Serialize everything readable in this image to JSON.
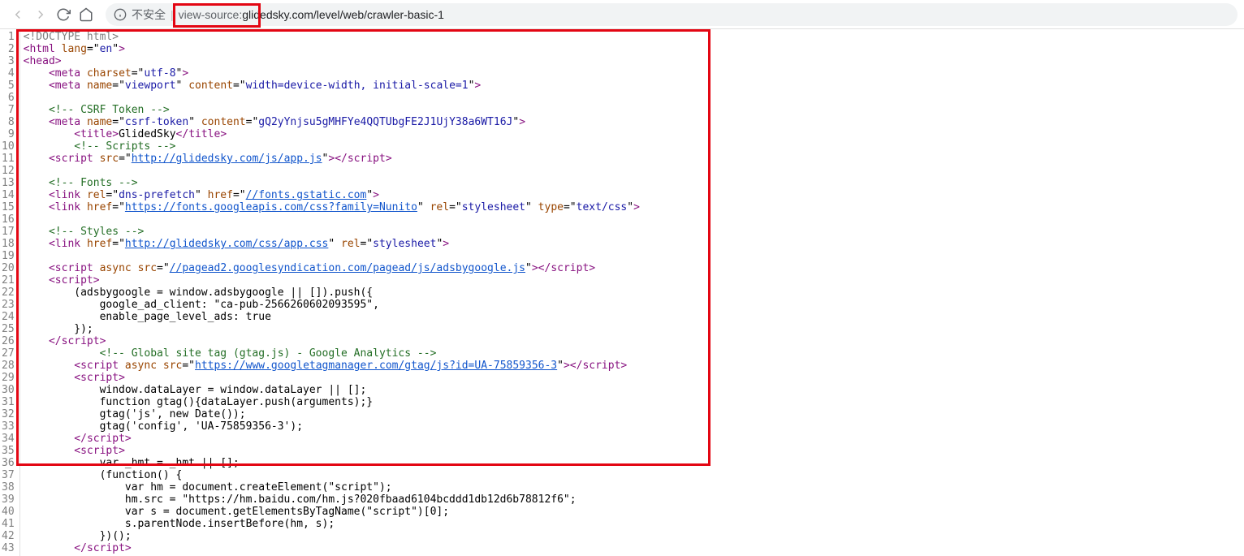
{
  "browser": {
    "security_label": "不安全",
    "url_prefix": "view-source:",
    "url_rest": "glidedsky.com/level/web/crawler-basic-1"
  },
  "lines": [
    {
      "n": "1",
      "segs": [
        {
          "c": "t-doctype",
          "t": "<!DOCTYPE html>"
        }
      ]
    },
    {
      "n": "2",
      "segs": [
        {
          "c": "t-punc",
          "t": "<"
        },
        {
          "c": "t-tag",
          "t": "html"
        },
        {
          "c": "t-text",
          "t": " "
        },
        {
          "c": "t-attr",
          "t": "lang"
        },
        {
          "c": "t-text",
          "t": "=\""
        },
        {
          "c": "t-val",
          "t": "en"
        },
        {
          "c": "t-text",
          "t": "\""
        },
        {
          "c": "t-punc",
          "t": ">"
        }
      ]
    },
    {
      "n": "3",
      "segs": [
        {
          "c": "t-punc",
          "t": "<"
        },
        {
          "c": "t-tag",
          "t": "head"
        },
        {
          "c": "t-punc",
          "t": ">"
        }
      ]
    },
    {
      "n": "4",
      "segs": [
        {
          "c": "t-text",
          "t": "    "
        },
        {
          "c": "t-punc",
          "t": "<"
        },
        {
          "c": "t-tag",
          "t": "meta"
        },
        {
          "c": "t-text",
          "t": " "
        },
        {
          "c": "t-attr",
          "t": "charset"
        },
        {
          "c": "t-text",
          "t": "=\""
        },
        {
          "c": "t-val",
          "t": "utf-8"
        },
        {
          "c": "t-text",
          "t": "\""
        },
        {
          "c": "t-punc",
          "t": ">"
        }
      ]
    },
    {
      "n": "5",
      "segs": [
        {
          "c": "t-text",
          "t": "    "
        },
        {
          "c": "t-punc",
          "t": "<"
        },
        {
          "c": "t-tag",
          "t": "meta"
        },
        {
          "c": "t-text",
          "t": " "
        },
        {
          "c": "t-attr",
          "t": "name"
        },
        {
          "c": "t-text",
          "t": "=\""
        },
        {
          "c": "t-val",
          "t": "viewport"
        },
        {
          "c": "t-text",
          "t": "\" "
        },
        {
          "c": "t-attr",
          "t": "content"
        },
        {
          "c": "t-text",
          "t": "=\""
        },
        {
          "c": "t-val",
          "t": "width=device-width, initial-scale=1"
        },
        {
          "c": "t-text",
          "t": "\""
        },
        {
          "c": "t-punc",
          "t": ">"
        }
      ]
    },
    {
      "n": "6",
      "segs": []
    },
    {
      "n": "7",
      "segs": [
        {
          "c": "t-text",
          "t": "    "
        },
        {
          "c": "t-comment",
          "t": "<!-- CSRF Token -->"
        }
      ]
    },
    {
      "n": "8",
      "segs": [
        {
          "c": "t-text",
          "t": "    "
        },
        {
          "c": "t-punc",
          "t": "<"
        },
        {
          "c": "t-tag",
          "t": "meta"
        },
        {
          "c": "t-text",
          "t": " "
        },
        {
          "c": "t-attr",
          "t": "name"
        },
        {
          "c": "t-text",
          "t": "=\""
        },
        {
          "c": "t-val",
          "t": "csrf-token"
        },
        {
          "c": "t-text",
          "t": "\" "
        },
        {
          "c": "t-attr",
          "t": "content"
        },
        {
          "c": "t-text",
          "t": "=\""
        },
        {
          "c": "t-val",
          "t": "gQ2yYnjsu5gMHFYe4QQTUbgFE2J1UjY38a6WT16J"
        },
        {
          "c": "t-text",
          "t": "\""
        },
        {
          "c": "t-punc",
          "t": ">"
        }
      ]
    },
    {
      "n": "9",
      "segs": [
        {
          "c": "t-text",
          "t": "        "
        },
        {
          "c": "t-punc",
          "t": "<"
        },
        {
          "c": "t-tag",
          "t": "title"
        },
        {
          "c": "t-punc",
          "t": ">"
        },
        {
          "c": "t-text",
          "t": "GlidedSky"
        },
        {
          "c": "t-punc",
          "t": "</"
        },
        {
          "c": "t-tag",
          "t": "title"
        },
        {
          "c": "t-punc",
          "t": ">"
        }
      ]
    },
    {
      "n": "10",
      "segs": [
        {
          "c": "t-text",
          "t": "        "
        },
        {
          "c": "t-comment",
          "t": "<!-- Scripts -->"
        }
      ]
    },
    {
      "n": "11",
      "segs": [
        {
          "c": "t-text",
          "t": "    "
        },
        {
          "c": "t-punc",
          "t": "<"
        },
        {
          "c": "t-tag",
          "t": "script"
        },
        {
          "c": "t-text",
          "t": " "
        },
        {
          "c": "t-attr",
          "t": "src"
        },
        {
          "c": "t-text",
          "t": "=\""
        },
        {
          "c": "t-link",
          "t": "http://glidedsky.com/js/app.js"
        },
        {
          "c": "t-text",
          "t": "\""
        },
        {
          "c": "t-punc",
          "t": "></"
        },
        {
          "c": "t-tag",
          "t": "script"
        },
        {
          "c": "t-punc",
          "t": ">"
        }
      ]
    },
    {
      "n": "12",
      "segs": []
    },
    {
      "n": "13",
      "segs": [
        {
          "c": "t-text",
          "t": "    "
        },
        {
          "c": "t-comment",
          "t": "<!-- Fonts -->"
        }
      ]
    },
    {
      "n": "14",
      "segs": [
        {
          "c": "t-text",
          "t": "    "
        },
        {
          "c": "t-punc",
          "t": "<"
        },
        {
          "c": "t-tag",
          "t": "link"
        },
        {
          "c": "t-text",
          "t": " "
        },
        {
          "c": "t-attr",
          "t": "rel"
        },
        {
          "c": "t-text",
          "t": "=\""
        },
        {
          "c": "t-val",
          "t": "dns-prefetch"
        },
        {
          "c": "t-text",
          "t": "\" "
        },
        {
          "c": "t-attr",
          "t": "href"
        },
        {
          "c": "t-text",
          "t": "=\""
        },
        {
          "c": "t-link",
          "t": "//fonts.gstatic.com"
        },
        {
          "c": "t-text",
          "t": "\""
        },
        {
          "c": "t-punc",
          "t": ">"
        }
      ]
    },
    {
      "n": "15",
      "segs": [
        {
          "c": "t-text",
          "t": "    "
        },
        {
          "c": "t-punc",
          "t": "<"
        },
        {
          "c": "t-tag",
          "t": "link"
        },
        {
          "c": "t-text",
          "t": " "
        },
        {
          "c": "t-attr",
          "t": "href"
        },
        {
          "c": "t-text",
          "t": "=\""
        },
        {
          "c": "t-link",
          "t": "https://fonts.googleapis.com/css?family=Nunito"
        },
        {
          "c": "t-text",
          "t": "\" "
        },
        {
          "c": "t-attr",
          "t": "rel"
        },
        {
          "c": "t-text",
          "t": "=\""
        },
        {
          "c": "t-val",
          "t": "stylesheet"
        },
        {
          "c": "t-text",
          "t": "\" "
        },
        {
          "c": "t-attr",
          "t": "type"
        },
        {
          "c": "t-text",
          "t": "=\""
        },
        {
          "c": "t-val",
          "t": "text/css"
        },
        {
          "c": "t-text",
          "t": "\""
        },
        {
          "c": "t-punc",
          "t": ">"
        }
      ]
    },
    {
      "n": "16",
      "segs": []
    },
    {
      "n": "17",
      "segs": [
        {
          "c": "t-text",
          "t": "    "
        },
        {
          "c": "t-comment",
          "t": "<!-- Styles -->"
        }
      ]
    },
    {
      "n": "18",
      "segs": [
        {
          "c": "t-text",
          "t": "    "
        },
        {
          "c": "t-punc",
          "t": "<"
        },
        {
          "c": "t-tag",
          "t": "link"
        },
        {
          "c": "t-text",
          "t": " "
        },
        {
          "c": "t-attr",
          "t": "href"
        },
        {
          "c": "t-text",
          "t": "=\""
        },
        {
          "c": "t-link",
          "t": "http://glidedsky.com/css/app.css"
        },
        {
          "c": "t-text",
          "t": "\" "
        },
        {
          "c": "t-attr",
          "t": "rel"
        },
        {
          "c": "t-text",
          "t": "=\""
        },
        {
          "c": "t-val",
          "t": "stylesheet"
        },
        {
          "c": "t-text",
          "t": "\""
        },
        {
          "c": "t-punc",
          "t": ">"
        }
      ]
    },
    {
      "n": "19",
      "segs": []
    },
    {
      "n": "20",
      "segs": [
        {
          "c": "t-text",
          "t": "    "
        },
        {
          "c": "t-punc",
          "t": "<"
        },
        {
          "c": "t-tag",
          "t": "script"
        },
        {
          "c": "t-text",
          "t": " "
        },
        {
          "c": "t-attr",
          "t": "async"
        },
        {
          "c": "t-text",
          "t": " "
        },
        {
          "c": "t-attr",
          "t": "src"
        },
        {
          "c": "t-text",
          "t": "=\""
        },
        {
          "c": "t-link",
          "t": "//pagead2.googlesyndication.com/pagead/js/adsbygoogle.js"
        },
        {
          "c": "t-text",
          "t": "\""
        },
        {
          "c": "t-punc",
          "t": "></"
        },
        {
          "c": "t-tag",
          "t": "script"
        },
        {
          "c": "t-punc",
          "t": ">"
        }
      ]
    },
    {
      "n": "21",
      "segs": [
        {
          "c": "t-text",
          "t": "    "
        },
        {
          "c": "t-punc",
          "t": "<"
        },
        {
          "c": "t-tag",
          "t": "script"
        },
        {
          "c": "t-punc",
          "t": ">"
        }
      ]
    },
    {
      "n": "22",
      "segs": [
        {
          "c": "t-text",
          "t": "        (adsbygoogle = window.adsbygoogle || []).push({"
        }
      ]
    },
    {
      "n": "23",
      "segs": [
        {
          "c": "t-text",
          "t": "            google_ad_client: \"ca-pub-2566260602093595\","
        }
      ]
    },
    {
      "n": "24",
      "segs": [
        {
          "c": "t-text",
          "t": "            enable_page_level_ads: true"
        }
      ]
    },
    {
      "n": "25",
      "segs": [
        {
          "c": "t-text",
          "t": "        });"
        }
      ]
    },
    {
      "n": "26",
      "segs": [
        {
          "c": "t-text",
          "t": "    "
        },
        {
          "c": "t-punc",
          "t": "</"
        },
        {
          "c": "t-tag",
          "t": "script"
        },
        {
          "c": "t-punc",
          "t": ">"
        }
      ]
    },
    {
      "n": "27",
      "segs": [
        {
          "c": "t-text",
          "t": "            "
        },
        {
          "c": "t-comment",
          "t": "<!-- Global site tag (gtag.js) - Google Analytics -->"
        }
      ]
    },
    {
      "n": "28",
      "segs": [
        {
          "c": "t-text",
          "t": "        "
        },
        {
          "c": "t-punc",
          "t": "<"
        },
        {
          "c": "t-tag",
          "t": "script"
        },
        {
          "c": "t-text",
          "t": " "
        },
        {
          "c": "t-attr",
          "t": "async"
        },
        {
          "c": "t-text",
          "t": " "
        },
        {
          "c": "t-attr",
          "t": "src"
        },
        {
          "c": "t-text",
          "t": "=\""
        },
        {
          "c": "t-link",
          "t": "https://www.googletagmanager.com/gtag/js?id=UA-75859356-3"
        },
        {
          "c": "t-text",
          "t": "\""
        },
        {
          "c": "t-punc",
          "t": "></"
        },
        {
          "c": "t-tag",
          "t": "script"
        },
        {
          "c": "t-punc",
          "t": ">"
        }
      ]
    },
    {
      "n": "29",
      "segs": [
        {
          "c": "t-text",
          "t": "        "
        },
        {
          "c": "t-punc",
          "t": "<"
        },
        {
          "c": "t-tag",
          "t": "script"
        },
        {
          "c": "t-punc",
          "t": ">"
        }
      ]
    },
    {
      "n": "30",
      "segs": [
        {
          "c": "t-text",
          "t": "            window.dataLayer = window.dataLayer || [];"
        }
      ]
    },
    {
      "n": "31",
      "segs": [
        {
          "c": "t-text",
          "t": "            function gtag(){dataLayer.push(arguments);}"
        }
      ]
    },
    {
      "n": "32",
      "segs": [
        {
          "c": "t-text",
          "t": "            gtag('js', new Date());"
        }
      ]
    },
    {
      "n": "33",
      "segs": [
        {
          "c": "t-text",
          "t": "            gtag('config', 'UA-75859356-3');"
        }
      ]
    },
    {
      "n": "34",
      "segs": [
        {
          "c": "t-text",
          "t": "        "
        },
        {
          "c": "t-punc",
          "t": "</"
        },
        {
          "c": "t-tag",
          "t": "script"
        },
        {
          "c": "t-punc",
          "t": ">"
        }
      ]
    },
    {
      "n": "35",
      "segs": [
        {
          "c": "t-text",
          "t": "        "
        },
        {
          "c": "t-punc",
          "t": "<"
        },
        {
          "c": "t-tag",
          "t": "script"
        },
        {
          "c": "t-punc",
          "t": ">"
        }
      ]
    },
    {
      "n": "36",
      "segs": [
        {
          "c": "t-text",
          "t": "            var _hmt = _hmt || [];"
        }
      ]
    },
    {
      "n": "37",
      "segs": [
        {
          "c": "t-text",
          "t": "            (function() {"
        }
      ]
    },
    {
      "n": "38",
      "segs": [
        {
          "c": "t-text",
          "t": "                var hm = document.createElement(\"script\");"
        }
      ]
    },
    {
      "n": "39",
      "segs": [
        {
          "c": "t-text",
          "t": "                hm.src = \"https://hm.baidu.com/hm.js?020fbaad6104bcddd1db12d6b78812f6\";"
        }
      ]
    },
    {
      "n": "40",
      "segs": [
        {
          "c": "t-text",
          "t": "                var s = document.getElementsByTagName(\"script\")[0];"
        }
      ]
    },
    {
      "n": "41",
      "segs": [
        {
          "c": "t-text",
          "t": "                s.parentNode.insertBefore(hm, s);"
        }
      ]
    },
    {
      "n": "42",
      "segs": [
        {
          "c": "t-text",
          "t": "            })();"
        }
      ]
    },
    {
      "n": "43",
      "segs": [
        {
          "c": "t-text",
          "t": "        "
        },
        {
          "c": "t-punc",
          "t": "</"
        },
        {
          "c": "t-tag",
          "t": "script"
        },
        {
          "c": "t-punc",
          "t": ">"
        }
      ]
    }
  ]
}
